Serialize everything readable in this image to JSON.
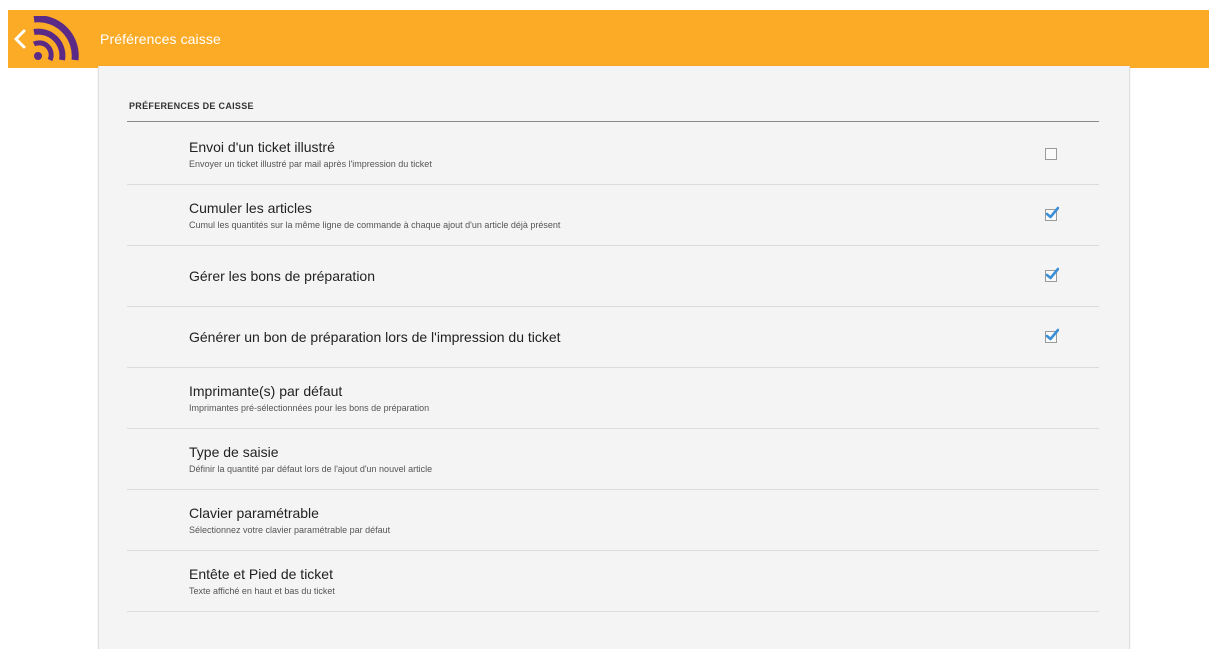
{
  "app_bar": {
    "title": "Préférences caisse",
    "background_color": "#fbab26",
    "back_icon": "chevron-left-icon",
    "logo_icon": "signal-waves-logo"
  },
  "section": {
    "header": "PRÉFERENCES DE CAISSE"
  },
  "preferences": [
    {
      "title": "Envoi d'un ticket illustré",
      "summary": "Envoyer un ticket illustré par mail après l'impression du ticket",
      "checkbox": true,
      "checked": false
    },
    {
      "title": "Cumuler les articles",
      "summary": "Cumul les quantités sur la même ligne de commande à chaque ajout d'un article déjà présent",
      "checkbox": true,
      "checked": true
    },
    {
      "title": "Gérer les bons de préparation",
      "summary": "",
      "checkbox": true,
      "checked": true
    },
    {
      "title": "Générer un bon de préparation lors de l'impression du ticket",
      "summary": "",
      "checkbox": true,
      "checked": true
    },
    {
      "title": "Imprimante(s) par défaut",
      "summary": "Imprimantes pré-sélectionnées pour les bons de préparation",
      "checkbox": false,
      "checked": false
    },
    {
      "title": "Type de saisie",
      "summary": "Définir la quantité par défaut lors de l'ajout d'un nouvel article",
      "checkbox": false,
      "checked": false
    },
    {
      "title": "Clavier paramétrable",
      "summary": "Sélectionnez votre clavier paramétrable par défaut",
      "checkbox": false,
      "checked": false
    },
    {
      "title": "Entête et Pied de ticket",
      "summary": "Texte affiché en haut et bas du ticket",
      "checkbox": false,
      "checked": false
    }
  ],
  "colors": {
    "check_mark": "#3a8fd6",
    "accent_logo": "#5b2a86"
  }
}
